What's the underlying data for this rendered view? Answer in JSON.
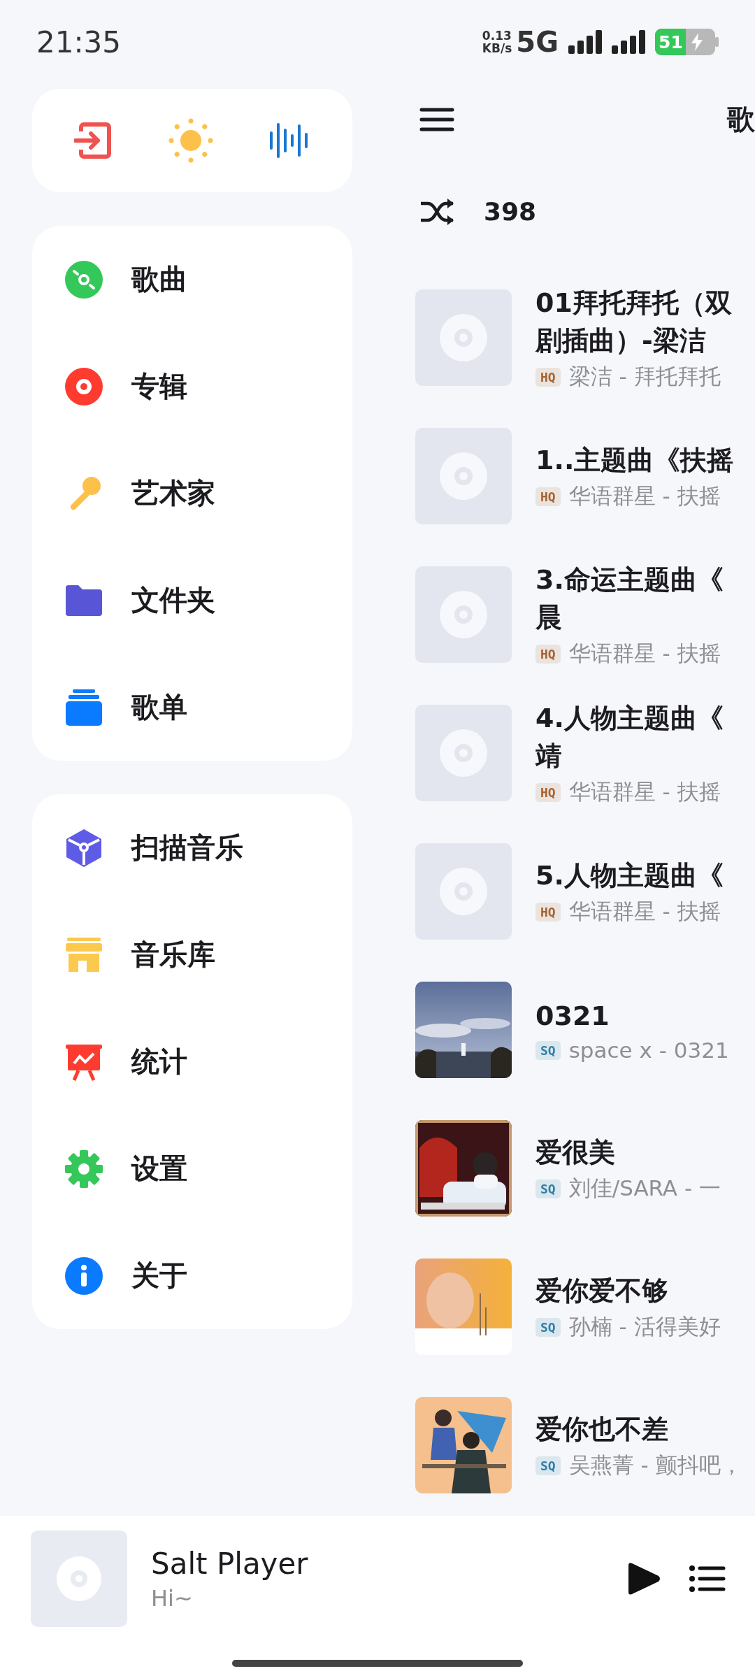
{
  "status_bar": {
    "time": "21:35",
    "net_speed": "0.13",
    "net_unit": "KB/s",
    "network": "5G",
    "battery": "51",
    "charging": true
  },
  "drawer": {
    "menu_groups": [
      [
        {
          "label": "歌曲",
          "color": "#34c759"
        },
        {
          "label": "专辑",
          "color": "#ff3b30"
        },
        {
          "label": "艺术家",
          "color": "#fcc14a"
        },
        {
          "label": "文件夹",
          "color": "#5856d6"
        },
        {
          "label": "歌单",
          "color": "#0a7aff"
        }
      ],
      [
        {
          "label": "扫描音乐",
          "color": "#5e5ce6"
        },
        {
          "label": "音乐库",
          "color": "#fcc94f"
        },
        {
          "label": "统计",
          "color": "#ff3b30"
        },
        {
          "label": "设置",
          "color": "#34c759"
        },
        {
          "label": "关于",
          "color": "#0a7aff"
        }
      ]
    ]
  },
  "header": {
    "title": "歌"
  },
  "shuffle": {
    "count": "398"
  },
  "songs": [
    {
      "title_lines": [
        "01拜托拜托（双",
        "剧插曲）-梁洁"
      ],
      "badge": {
        "text": "HQ",
        "color": "#a8622d"
      },
      "subtitle": "梁洁 - 拜托拜托",
      "kind": "placeholder"
    },
    {
      "title_lines": [
        "1..主题曲《扶摇"
      ],
      "badge": {
        "text": "HQ",
        "color": "#a8622d"
      },
      "subtitle": "华语群星 - 扶摇",
      "kind": "placeholder"
    },
    {
      "title_lines": [
        "3.命运主题曲《",
        "晨"
      ],
      "badge": {
        "text": "HQ",
        "color": "#a8622d"
      },
      "subtitle": "华语群星 - 扶摇",
      "kind": "placeholder"
    },
    {
      "title_lines": [
        "4.人物主题曲《",
        "靖"
      ],
      "badge": {
        "text": "HQ",
        "color": "#a8622d"
      },
      "subtitle": "华语群星 - 扶摇",
      "kind": "placeholder"
    },
    {
      "title_lines": [
        "5.人物主题曲《"
      ],
      "badge": {
        "text": "HQ",
        "color": "#a8622d"
      },
      "subtitle": "华语群星 - 扶摇",
      "kind": "placeholder"
    },
    {
      "title_lines": [
        "0321"
      ],
      "badge": {
        "text": "SQ",
        "color": "#2f7fa8"
      },
      "subtitle": "space x - 0321",
      "kind": "picture"
    },
    {
      "title_lines": [
        "爱很美"
      ],
      "badge": {
        "text": "SQ",
        "color": "#2f7fa8"
      },
      "subtitle": "刘佳/SARA - 一",
      "kind": "picture"
    },
    {
      "title_lines": [
        "爱你爱不够"
      ],
      "badge": {
        "text": "SQ",
        "color": "#2f7fa8"
      },
      "subtitle": "孙楠 - 活得美好",
      "kind": "picture"
    },
    {
      "title_lines": [
        "爱你也不差"
      ],
      "badge": {
        "text": "SQ",
        "color": "#2f7fa8"
      },
      "subtitle": "吴燕菁 - 颤抖吧，",
      "kind": "picture"
    }
  ],
  "now_playing": {
    "title": "Salt Player",
    "subtitle": "Hi~",
    "playing": false
  }
}
